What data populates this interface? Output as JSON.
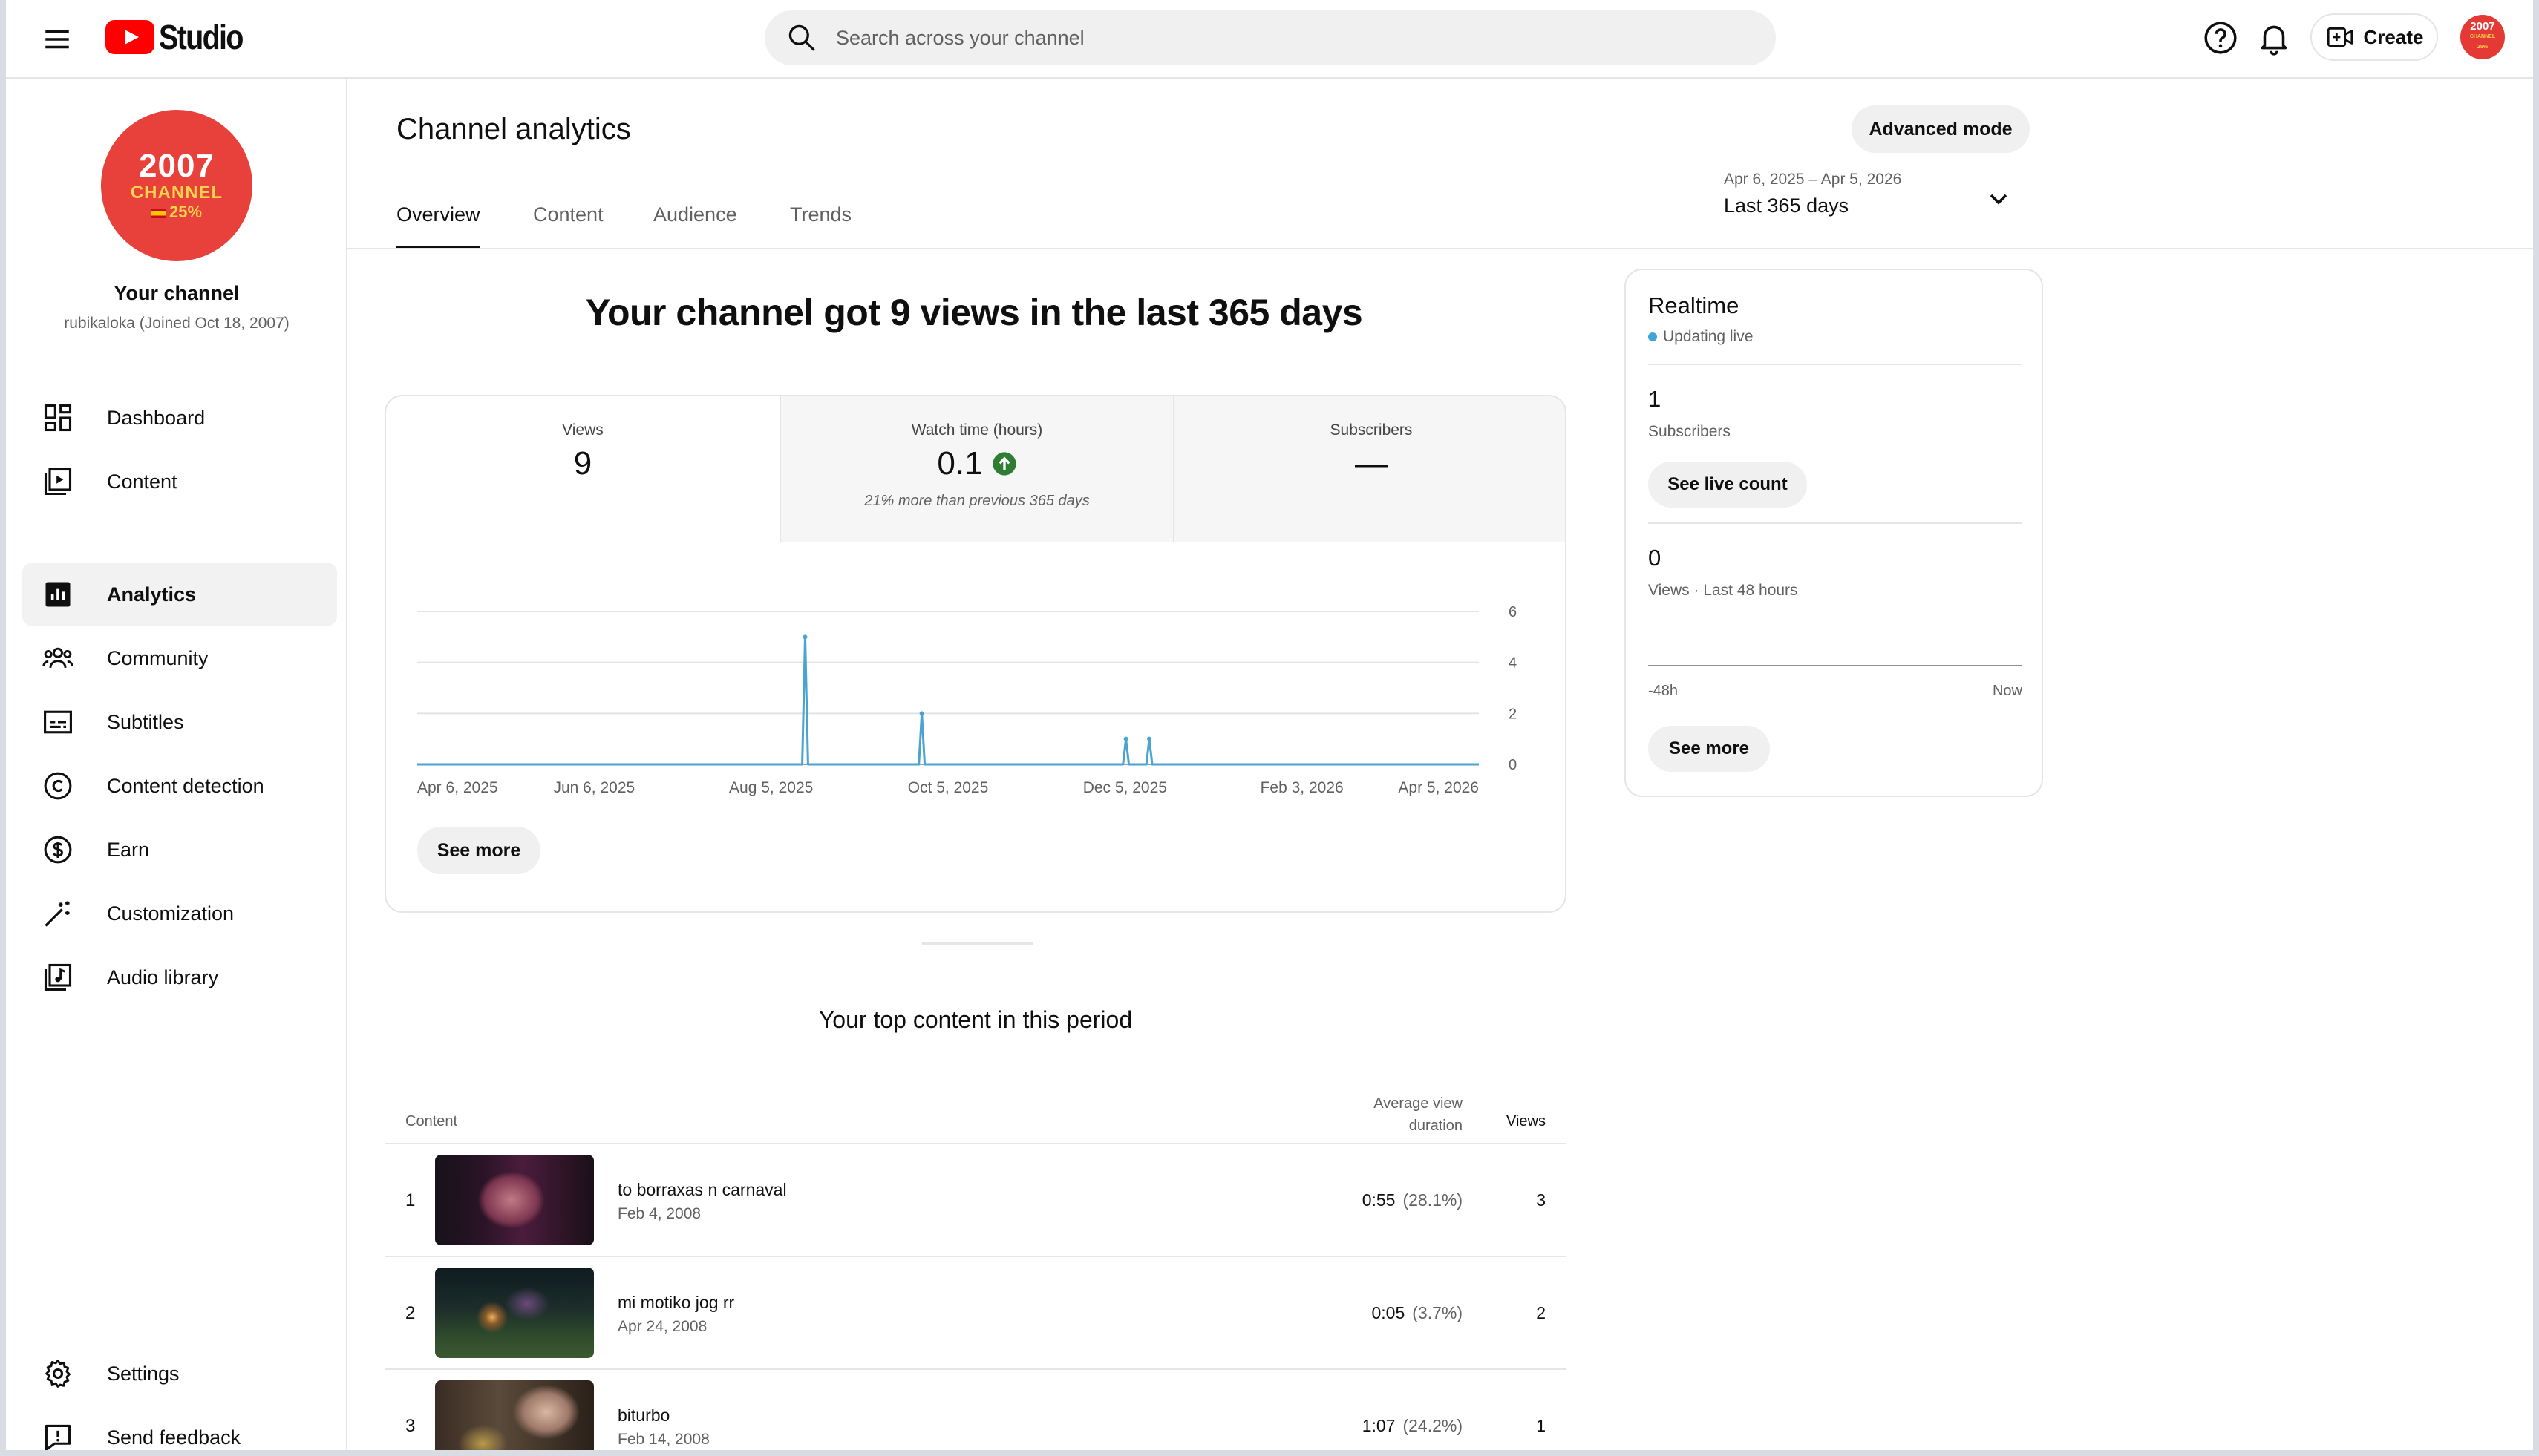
{
  "app": {
    "logo_text": "Studio"
  },
  "search": {
    "placeholder": "Search across your channel"
  },
  "header": {
    "create_label": "Create",
    "avatar_text_1": "2007",
    "avatar_text_2": "CHANNEL",
    "avatar_text_3": "25%"
  },
  "sidebar": {
    "avatar_line1": "2007",
    "avatar_line2": "CHANNEL",
    "avatar_line3": "25%",
    "channel_name": "Your channel",
    "channel_sub": "rubikaloka (Joined Oct 18, 2007)",
    "items": [
      {
        "label": "Dashboard",
        "icon": "dashboard-icon"
      },
      {
        "label": "Content",
        "icon": "content-icon"
      },
      {
        "label": "Analytics",
        "icon": "analytics-icon",
        "active": true
      },
      {
        "label": "Community",
        "icon": "community-icon"
      },
      {
        "label": "Subtitles",
        "icon": "subtitles-icon"
      },
      {
        "label": "Content detection",
        "icon": "copyright-icon"
      },
      {
        "label": "Earn",
        "icon": "dollar-icon"
      },
      {
        "label": "Customization",
        "icon": "magic-wand-icon"
      },
      {
        "label": "Audio library",
        "icon": "audio-library-icon"
      }
    ],
    "bottom_items": [
      {
        "label": "Settings",
        "icon": "gear-icon"
      },
      {
        "label": "Send feedback",
        "icon": "feedback-icon"
      }
    ]
  },
  "page": {
    "title": "Channel analytics",
    "advanced_mode": "Advanced mode",
    "tabs": [
      "Overview",
      "Content",
      "Audience",
      "Trends"
    ],
    "active_tab": "Overview",
    "date_range": "Apr 6, 2025 – Apr 5, 2026",
    "date_preset": "Last 365 days",
    "headline": "Your channel got 9 views in the last 365 days"
  },
  "metrics": [
    {
      "label": "Views",
      "value": "9"
    },
    {
      "label": "Watch time (hours)",
      "value": "0.1",
      "note": "21% more than previous 365 days",
      "trend": "up"
    },
    {
      "label": "Subscribers",
      "value": "—"
    }
  ],
  "chart_data": {
    "type": "line",
    "title": "",
    "xlabel": "",
    "ylabel": "",
    "ylim": [
      0,
      6
    ],
    "yticks": [
      "0",
      "2",
      "4",
      "6"
    ],
    "xticks": [
      "Apr 6, 2025",
      "Jun 6, 2025",
      "Aug 5, 2025",
      "Oct 5, 2025",
      "Dec 5, 2025",
      "Feb 3, 2026",
      "Apr 5, 2026"
    ],
    "x_start": "2025-04-06",
    "x_end": "2026-04-05",
    "grid": true,
    "color": "#4aa3d0",
    "nonzero_points": [
      {
        "x": "2025-08-17",
        "y": 5
      },
      {
        "x": "2025-09-26",
        "y": 2
      },
      {
        "x": "2025-12-05",
        "y": 1
      },
      {
        "x": "2025-12-13",
        "y": 1
      }
    ]
  },
  "chart_see_more": "See more",
  "top_content": {
    "title": "Your top content in this period",
    "col_content": "Content",
    "col_avg_1": "Average view",
    "col_avg_2": "duration",
    "col_views": "Views",
    "rows": [
      {
        "rank": "1",
        "title": "to borraxas n carnaval",
        "date": "Feb 4, 2008",
        "duration": "0:55",
        "pct": "(28.1%)",
        "views": "3"
      },
      {
        "rank": "2",
        "title": "mi motiko jog rr",
        "date": "Apr 24, 2008",
        "duration": "0:05",
        "pct": "(3.7%)",
        "views": "2"
      },
      {
        "rank": "3",
        "title": "biturbo",
        "date": "Feb 14, 2008",
        "duration": "1:07",
        "pct": "(24.2%)",
        "views": "1"
      }
    ]
  },
  "realtime": {
    "title": "Realtime",
    "live": "Updating live",
    "subs_value": "1",
    "subs_label": "Subscribers",
    "live_count_btn": "See live count",
    "views_value": "0",
    "views_label": "Views · Last 48 hours",
    "tick_left": "-48h",
    "tick_right": "Now",
    "see_more": "See more"
  }
}
